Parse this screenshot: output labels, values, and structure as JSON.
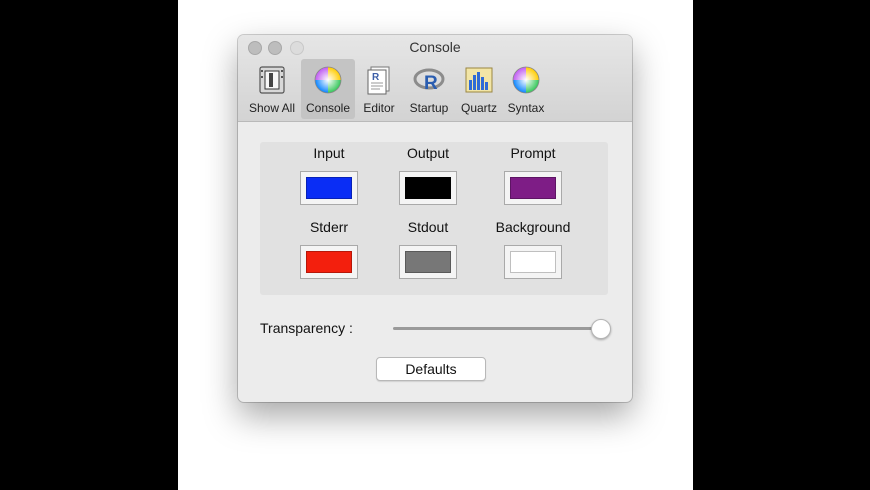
{
  "window": {
    "title": "Console"
  },
  "toolbar": {
    "items": [
      {
        "label": "Show All",
        "icon": "grid-icon"
      },
      {
        "label": "Console",
        "icon": "color-wheel-icon",
        "active": true
      },
      {
        "label": "Editor",
        "icon": "document-icon"
      },
      {
        "label": "Startup",
        "icon": "r-logo-icon"
      },
      {
        "label": "Quartz",
        "icon": "quartz-graph-icon"
      },
      {
        "label": "Syntax",
        "icon": "color-wheel-icon"
      }
    ]
  },
  "colors": {
    "items": [
      {
        "label": "Input",
        "color": "#0a2df5"
      },
      {
        "label": "Output",
        "color": "#000000"
      },
      {
        "label": "Prompt",
        "color": "#7e1d86"
      },
      {
        "label": "Stderr",
        "color": "#f31f0d"
      },
      {
        "label": "Stdout",
        "color": "#777777"
      },
      {
        "label": "Background",
        "color": "#ffffff"
      }
    ]
  },
  "transparency": {
    "label": "Transparency :",
    "value": 1.0
  },
  "defaults_label": "Defaults"
}
